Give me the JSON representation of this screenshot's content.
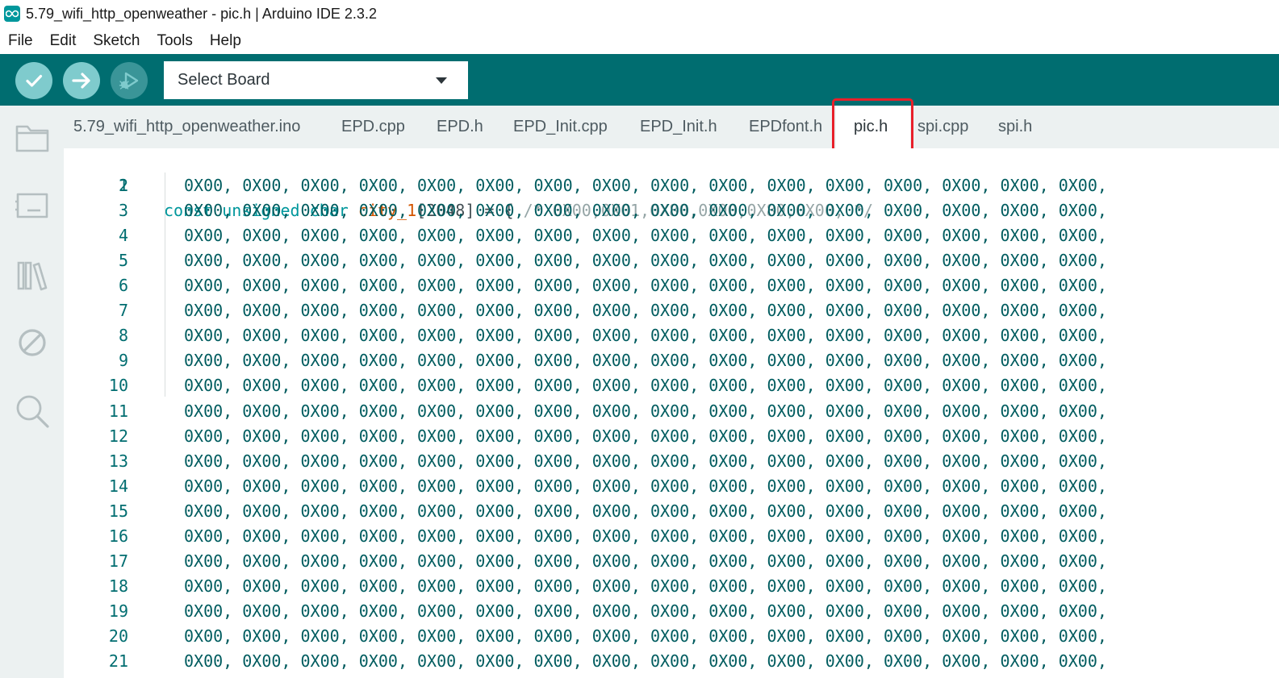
{
  "window": {
    "title": "5.79_wifi_http_openweather - pic.h | Arduino IDE 2.3.2"
  },
  "menu": {
    "items": [
      "File",
      "Edit",
      "Sketch",
      "Tools",
      "Help"
    ]
  },
  "toolbar": {
    "board_select_label": "Select Board",
    "buttons": [
      {
        "name": "verify",
        "icon": "check-icon"
      },
      {
        "name": "upload",
        "icon": "arrow-right-icon"
      },
      {
        "name": "debug",
        "icon": "debug-icon"
      }
    ]
  },
  "sidebar": {
    "icons": [
      "folder-icon",
      "board-manager-icon",
      "library-icon",
      "debug-disabled-icon",
      "search-icon"
    ]
  },
  "tabs": [
    {
      "label": "5.79_wifi_http_openweather.ino",
      "active": false
    },
    {
      "label": "EPD.cpp",
      "active": false
    },
    {
      "label": "EPD.h",
      "active": false
    },
    {
      "label": "EPD_Init.cpp",
      "active": false
    },
    {
      "label": "EPD_Init.h",
      "active": false
    },
    {
      "label": "EPDfont.h",
      "active": false
    },
    {
      "label": "pic.h",
      "active": true
    },
    {
      "label": "spi.cpp",
      "active": false
    },
    {
      "label": "spi.h",
      "active": false
    }
  ],
  "editor": {
    "first_line": {
      "number": "1",
      "kw1": "const",
      "kw2": "unsigned",
      "kw3": "char",
      "ident": "city_1",
      "rest": "[2048] = { ",
      "comment": "/* 0X00,0X01,0X80,0X00,0X80,0X00, */"
    },
    "lines": [
      {
        "number": "2",
        "text": "0X00, 0X00, 0X00, 0X00, 0X00, 0X00, 0X00, 0X00, 0X00, 0X00, 0X00, 0X00, 0X00, 0X00, 0X00, 0X00,"
      },
      {
        "number": "3",
        "text": "0X00, 0X00, 0X00, 0X00, 0X00, 0X00, 0X00, 0X00, 0X00, 0X00, 0X00, 0X00, 0X00, 0X00, 0X00, 0X00,"
      },
      {
        "number": "4",
        "text": "0X00, 0X00, 0X00, 0X00, 0X00, 0X00, 0X00, 0X00, 0X00, 0X00, 0X00, 0X00, 0X00, 0X00, 0X00, 0X00,"
      },
      {
        "number": "5",
        "text": "0X00, 0X00, 0X00, 0X00, 0X00, 0X00, 0X00, 0X00, 0X00, 0X00, 0X00, 0X00, 0X00, 0X00, 0X00, 0X00,"
      },
      {
        "number": "6",
        "text": "0X00, 0X00, 0X00, 0X00, 0X00, 0X00, 0X00, 0X00, 0X00, 0X00, 0X00, 0X00, 0X00, 0X00, 0X00, 0X00,"
      },
      {
        "number": "7",
        "text": "0X00, 0X00, 0X00, 0X00, 0X00, 0X00, 0X00, 0X00, 0X00, 0X00, 0X00, 0X00, 0X00, 0X00, 0X00, 0X00,"
      },
      {
        "number": "8",
        "text": "0X00, 0X00, 0X00, 0X00, 0X00, 0X00, 0X00, 0X00, 0X00, 0X00, 0X00, 0X00, 0X00, 0X00, 0X00, 0X00,"
      },
      {
        "number": "9",
        "text": "0X00, 0X00, 0X00, 0X00, 0X00, 0X00, 0X00, 0X00, 0X00, 0X00, 0X00, 0X00, 0X00, 0X00, 0X00, 0X00,"
      },
      {
        "number": "10",
        "text": "0X00, 0X00, 0X00, 0X00, 0X00, 0X00, 0X00, 0X00, 0X00, 0X00, 0X00, 0X00, 0X00, 0X00, 0X00, 0X00,"
      },
      {
        "number": "11",
        "text": "0X00, 0X00, 0X00, 0X00, 0X00, 0X00, 0X00, 0X00, 0X00, 0X00, 0X00, 0X00, 0X00, 0X00, 0X00, 0X00,"
      },
      {
        "number": "12",
        "text": "0X00, 0X00, 0X00, 0X00, 0X00, 0X00, 0X00, 0X00, 0X00, 0X00, 0X00, 0X00, 0X00, 0X00, 0X00, 0X00,"
      },
      {
        "number": "13",
        "text": "0X00, 0X00, 0X00, 0X00, 0X00, 0X00, 0X00, 0X00, 0X00, 0X00, 0X00, 0X00, 0X00, 0X00, 0X00, 0X00,"
      },
      {
        "number": "14",
        "text": "0X00, 0X00, 0X00, 0X00, 0X00, 0X00, 0X00, 0X00, 0X00, 0X00, 0X00, 0X00, 0X00, 0X00, 0X00, 0X00,"
      },
      {
        "number": "15",
        "text": "0X00, 0X00, 0X00, 0X00, 0X00, 0X00, 0X00, 0X00, 0X00, 0X00, 0X00, 0X00, 0X00, 0X00, 0X00, 0X00,"
      },
      {
        "number": "16",
        "text": "0X00, 0X00, 0X00, 0X00, 0X00, 0X00, 0X00, 0X00, 0X00, 0X00, 0X00, 0X00, 0X00, 0X00, 0X00, 0X00,"
      },
      {
        "number": "17",
        "text": "0X00, 0X00, 0X00, 0X00, 0X00, 0X00, 0X00, 0X00, 0X00, 0X00, 0X00, 0X00, 0X00, 0X00, 0X00, 0X00,"
      },
      {
        "number": "18",
        "text": "0X00, 0X00, 0X00, 0X00, 0X00, 0X00, 0X00, 0X00, 0X00, 0X00, 0X00, 0X00, 0X00, 0X00, 0X00, 0X00,"
      },
      {
        "number": "19",
        "text": "0X00, 0X00, 0X00, 0X00, 0X00, 0X00, 0X00, 0X00, 0X00, 0X00, 0X00, 0X00, 0X00, 0X00, 0X00, 0X00,"
      },
      {
        "number": "20",
        "text": "0X00, 0X00, 0X00, 0X00, 0X00, 0X00, 0X00, 0X00, 0X00, 0X00, 0X00, 0X00, 0X00, 0X00, 0X00, 0X00,"
      },
      {
        "number": "21",
        "text": "0X00, 0X00, 0X00, 0X00, 0X00, 0X00, 0X00, 0X00, 0X00, 0X00, 0X00, 0X00, 0X00, 0X00, 0X00, 0X00,"
      }
    ]
  },
  "colors": {
    "toolbar": "#006d70",
    "toolbar_button": "#7fcbcd",
    "sidebar": "#ecf1f1",
    "keyword": "#00979c",
    "identifier": "#d35400",
    "highlight_box": "#e8202a"
  }
}
